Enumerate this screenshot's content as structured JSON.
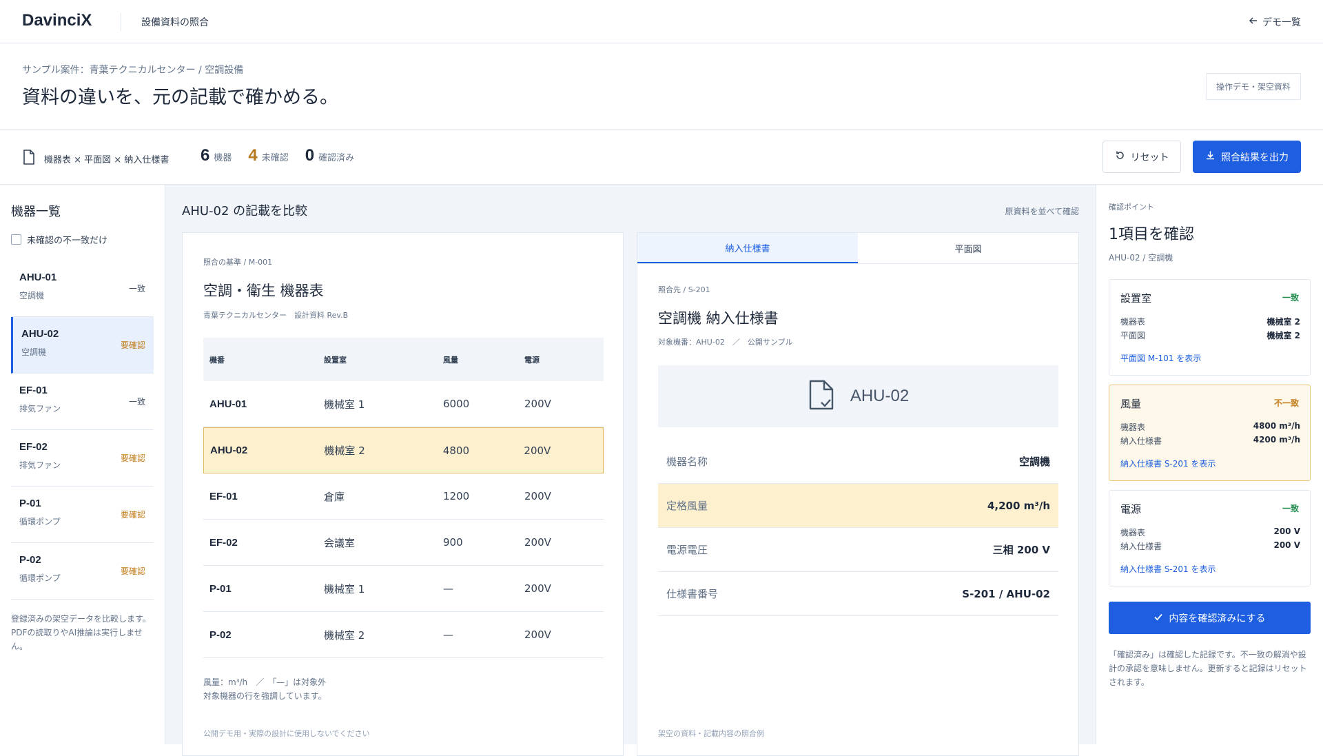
{
  "app": {
    "logo": "DavinciX",
    "subtitle": "設備資料の照合",
    "demo_link": "デモ一覧"
  },
  "hero": {
    "crumb": "サンプル案件：青葉テクニカルセンター / 空調設備",
    "title": "資料の違いを、元の記載で確かめる。",
    "badge": "操作デモ・架空資料"
  },
  "summary": {
    "sources": "機器表 × 平面図 × 納入仕様書",
    "stats": [
      {
        "num": "6",
        "label": "機器"
      },
      {
        "num": "4",
        "label": "未確認"
      },
      {
        "num": "0",
        "label": "確認済み"
      }
    ],
    "reset_label": "リセット",
    "export_label": "照合結果を出力"
  },
  "sidebar": {
    "title": "機器一覧",
    "filter_label": "未確認の不一致だけ",
    "items": [
      {
        "code": "AHU-01",
        "type": "空調機",
        "status": "一致"
      },
      {
        "code": "AHU-02",
        "type": "空調機",
        "status": "要確認"
      },
      {
        "code": "EF-01",
        "type": "排気ファン",
        "status": "一致"
      },
      {
        "code": "EF-02",
        "type": "排気ファン",
        "status": "要確認"
      },
      {
        "code": "P-01",
        "type": "循環ポンプ",
        "status": "要確認"
      },
      {
        "code": "P-02",
        "type": "循環ポンプ",
        "status": "要確認"
      }
    ],
    "note": "登録済みの架空データを比較します。PDFの読取りやAI推論は実行しません。"
  },
  "compare": {
    "title": "AHU-02 の記載を比較",
    "side_by_side_link": "原資料を並べて確認",
    "left": {
      "meta": "照合の基準 / M-001",
      "title": "空調・衛生 機器表",
      "subtitle": "青葉テクニカルセンター　設計資料 Rev.B",
      "headers": [
        "機番",
        "設置室",
        "風量",
        "電源"
      ],
      "rows": [
        [
          "AHU-01",
          "機械室 1",
          "6000",
          "200V"
        ],
        [
          "AHU-02",
          "機械室 2",
          "4800",
          "200V"
        ],
        [
          "EF-01",
          "倉庫",
          "1200",
          "200V"
        ],
        [
          "EF-02",
          "会議室",
          "900",
          "200V"
        ],
        [
          "P-01",
          "機械室 1",
          "—",
          "200V"
        ],
        [
          "P-02",
          "機械室 2",
          "—",
          "200V"
        ]
      ],
      "foot1": "風量：m³/h　／　「—」は対象外",
      "foot2": "対象機器の行を強調しています。",
      "disclaimer": "公開デモ用・実際の設計に使用しないでください"
    },
    "right": {
      "tabs": [
        "納入仕様書",
        "平面図"
      ],
      "meta": "照合先 / S-201",
      "title": "空調機 納入仕様書",
      "subtitle": "対象機番：AHU-02　／　公開サンプル",
      "hero_code": "AHU-02",
      "specs": [
        {
          "k": "機器名称",
          "v": "空調機"
        },
        {
          "k": "定格風量",
          "v": "4,200 m³/h"
        },
        {
          "k": "電源電圧",
          "v": "三相 200 V"
        },
        {
          "k": "仕様書番号",
          "v": "S-201 / AHU-02"
        }
      ],
      "disclaimer": "架空の資料・記載内容の照合例"
    }
  },
  "checkpoints": {
    "kicker": "確認ポイント",
    "title": "1項目を確認",
    "subtitle": "AHU-02 / 空調機",
    "cards": [
      {
        "head": "設置室",
        "status": "一致",
        "r1k": "機器表",
        "r1v": "機械室 2",
        "r2k": "平面図",
        "r2v": "機械室 2",
        "link": "平面図 M-101 を表示"
      },
      {
        "head": "風量",
        "status": "不一致",
        "r1k": "機器表",
        "r1v": "4800 m³/h",
        "r2k": "納入仕様書",
        "r2v": "4200 m³/h",
        "link": "納入仕様書 S-201 を表示"
      },
      {
        "head": "電源",
        "status": "一致",
        "r1k": "機器表",
        "r1v": "200 V",
        "r2k": "納入仕様書",
        "r2v": "200 V",
        "link": "納入仕様書 S-201 を表示"
      }
    ],
    "confirm_label": "内容を確認済みにする",
    "note": "「確認済み」は確認した記録です。不一致の解消や設計の承認を意味しません。更新すると記録はリセットされます。"
  },
  "colors": {
    "accent": "#1d5fe0",
    "warn": "#c27d1a",
    "ok": "#1f8a4c",
    "highlight": "#fdf0cf"
  }
}
